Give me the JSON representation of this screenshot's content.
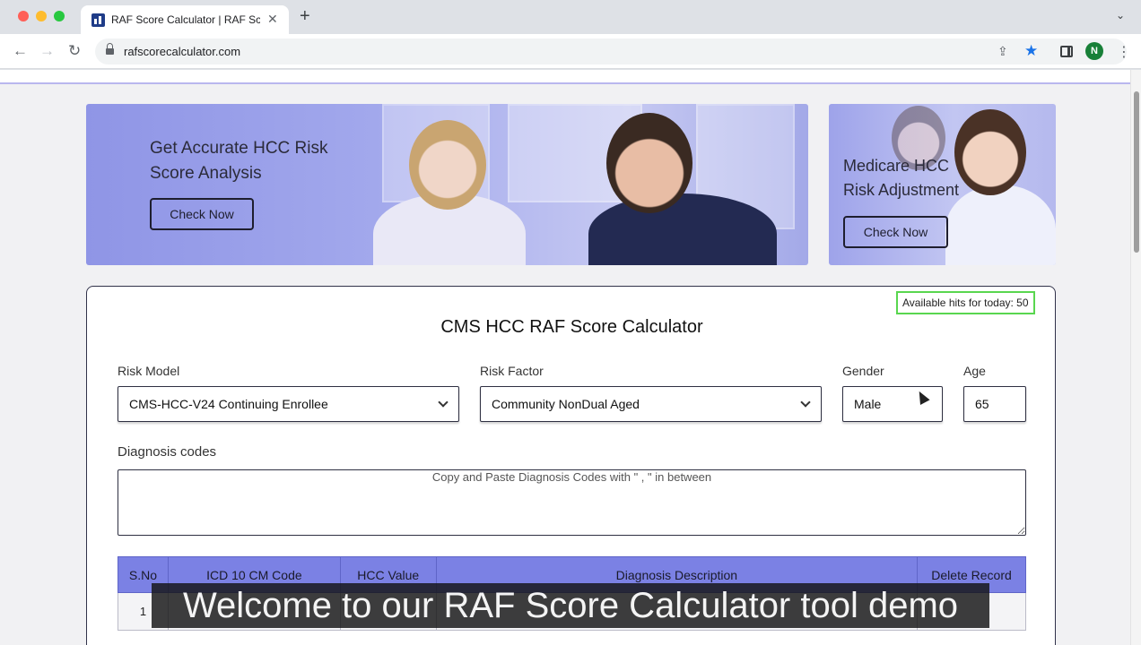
{
  "browser": {
    "tab_title": "RAF Score Calculator | RAF Sc",
    "tab_close": "✕",
    "new_tab": "+",
    "tab_menu": "⌄",
    "url": "rafscorecalculator.com",
    "avatar_initial": "N",
    "icons": {
      "back": "←",
      "forward": "→",
      "reload": "↻",
      "share": "⇪",
      "star": "★",
      "menu": "⋮"
    }
  },
  "banners": {
    "left": {
      "text_line1": "Get Accurate HCC Risk",
      "text_line2": "Score Analysis",
      "button": "Check Now"
    },
    "right": {
      "text_line1": "Medicare HCC",
      "text_line2": "Risk Adjustment",
      "button": "Check Now"
    }
  },
  "calculator": {
    "hits_badge": "Available hits for today: 50",
    "title": "CMS HCC RAF Score Calculator",
    "risk_model": {
      "label": "Risk Model",
      "value": "CMS-HCC-V24 Continuing Enrollee"
    },
    "risk_factor": {
      "label": "Risk Factor",
      "value": "Community NonDual Aged"
    },
    "gender": {
      "label": "Gender",
      "value": "Male"
    },
    "age": {
      "label": "Age",
      "value": "65"
    },
    "diagnosis": {
      "label": "Diagnosis codes",
      "placeholder": "Copy and Paste Diagnosis Codes with \" , \" in between"
    },
    "table": {
      "headers": [
        "S.No",
        "ICD 10 CM Code",
        "HCC Value",
        "Diagnosis Description",
        "Delete Record"
      ],
      "rows": [
        {
          "sno": "1"
        }
      ]
    }
  },
  "caption": "Welcome to our RAF Score Calculator tool demo",
  "colors": {
    "banner_accent": "#7b81e4",
    "hits_border": "#59d64f",
    "table_header": "#7b81e4"
  }
}
